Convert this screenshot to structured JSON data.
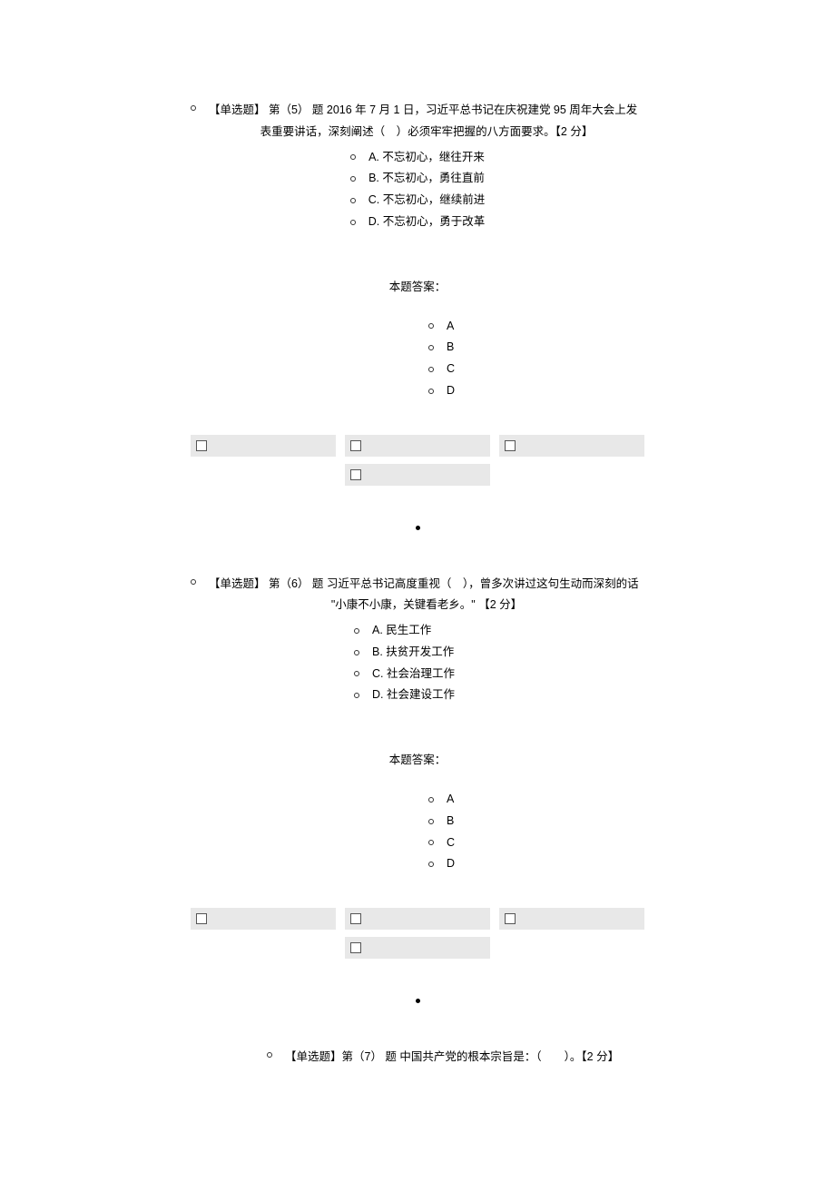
{
  "q5": {
    "prefix": "【单选题】 第（5） 题",
    "line1": "【单选题】 第（5） 题  2016 年 7 月 1 日，习近平总书记在庆祝建党 95 周年大会上发",
    "line2": "表重要讲话，深刻阐述（　）必须牢牢把握的八方面要求。【2 分】",
    "options": {
      "a": "A.  不忘初心，继往开来",
      "b": "B.  不忘初心，勇往直前",
      "c": "C.  不忘初心，继续前进",
      "d": "D.  不忘初心，勇于改革"
    }
  },
  "answer_label": "本题答案：",
  "answers": {
    "a": "A",
    "b": "B",
    "c": "C",
    "d": "D"
  },
  "q6": {
    "line1": "【单选题】 第（6） 题  习近平总书记高度重视（　），曾多次讲过这句生动而深刻的话",
    "line2": "\"小康不小康，关键看老乡。\" 【2 分】",
    "options": {
      "a": "A.  民生工作",
      "b": "B.  扶贫开发工作",
      "c": "C.  社会治理工作",
      "d": "D.  社会建设工作"
    }
  },
  "q7": {
    "text": "【单选题】第（7） 题  中国共产党的根本宗旨是：（　　）。【2 分】"
  }
}
